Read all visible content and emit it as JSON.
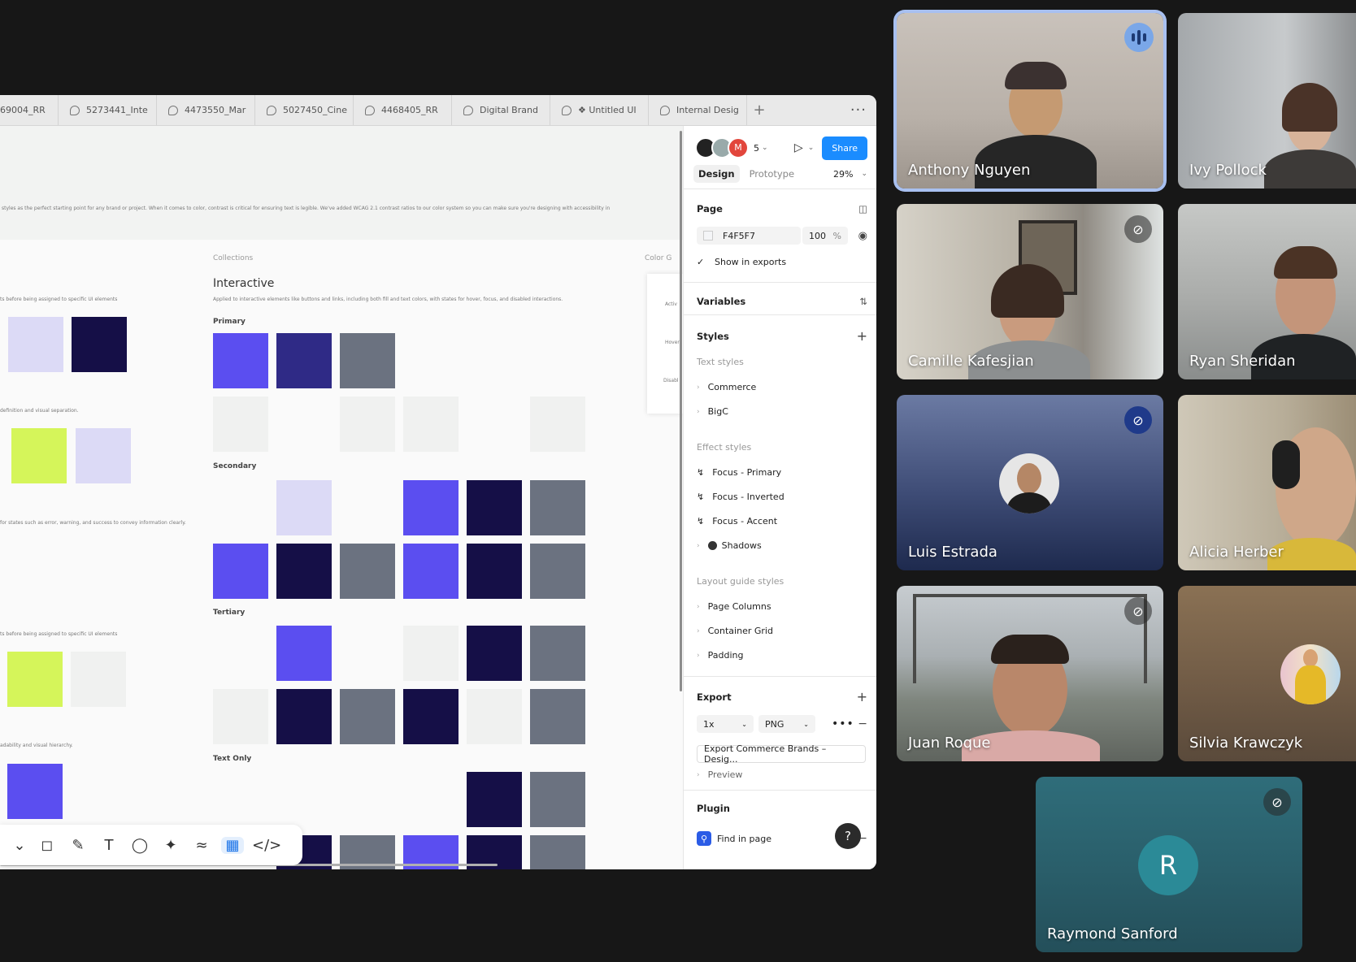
{
  "tabs": [
    "69004_RR",
    "5273441_Inte",
    "4473550_Mar",
    "5027450_Cine",
    "4468405_RR",
    "Digital Brand",
    "❖ Untitled UI",
    "Internal Desig"
  ],
  "canvas": {
    "intro": "styles as the perfect starting point for any brand or project. When it comes to color, contrast is critical for ensuring text is legible. We've added WCAG 2.1 contrast ratios to our color system so you can make sure you're designing with accessibility in",
    "collections_label": "Collections",
    "color_label": "Color G",
    "title": "Interactive",
    "desc": "Applied to interactive elements like buttons and links, including both fill and text colors, with states for hover, focus, and disabled interactions.",
    "left_notes": [
      "ts before being assigned to specific UI elements",
      "definition and visual separation.",
      "for states such as error, warning, and success to convey information clearly.",
      "ts before being assigned to specific UI elements",
      "adability and visual hierarchy."
    ],
    "sections": [
      "Primary",
      "Secondary",
      "Tertiary",
      "Text Only"
    ],
    "side_card_labels": [
      "Activ",
      "Hover",
      "Disabl"
    ]
  },
  "panel": {
    "avatar_letter": "M",
    "avatar_count": "5",
    "share": "Share",
    "tab_design": "Design",
    "tab_prototype": "Prototype",
    "zoom": "29%",
    "page_label": "Page",
    "page_color": "F4F5F7",
    "page_opacity": "100",
    "percent": "%",
    "show_exports": "Show in exports",
    "variables": "Variables",
    "styles": "Styles",
    "text_styles": "Text styles",
    "text_items": [
      "Commerce",
      "BigC"
    ],
    "effect_styles": "Effect styles",
    "effect_items": [
      "Focus - Primary",
      "Focus - Inverted",
      "Focus - Accent",
      "Shadows"
    ],
    "layout_styles": "Layout guide styles",
    "layout_items": [
      "Page Columns",
      "Container Grid",
      "Padding"
    ],
    "export": "Export",
    "export_scale": "1x",
    "export_format": "PNG",
    "export_button": "Export Commerce Brands – Desig...",
    "preview": "Preview",
    "plugin": "Plugin",
    "find_in_page": "Find in page",
    "help": "?"
  },
  "participants": [
    {
      "name": "Anthony Nguyen"
    },
    {
      "name": "Ivy Pollock"
    },
    {
      "name": "Camille Kafesjian"
    },
    {
      "name": "Ryan Sheridan"
    },
    {
      "name": "Luis Estrada"
    },
    {
      "name": "Alicia Herber"
    },
    {
      "name": "Juan Roque"
    },
    {
      "name": "Silvia Krawczyk"
    },
    {
      "name": "Raymond Sanford",
      "initial": "R"
    }
  ]
}
